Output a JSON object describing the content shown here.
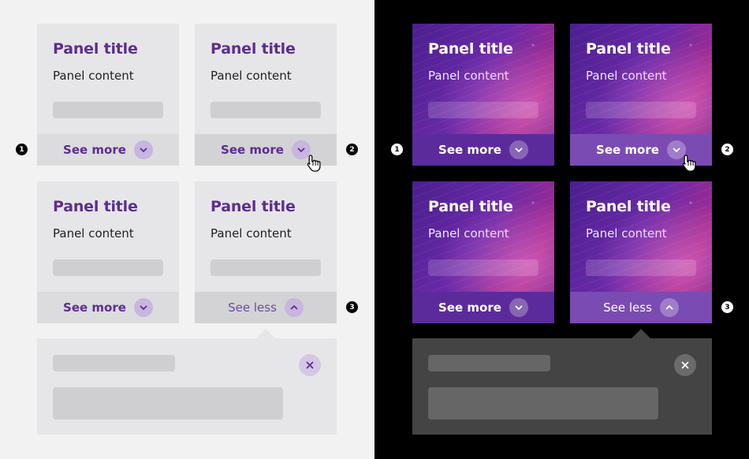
{
  "panel": {
    "title": "Panel title",
    "content": "Panel content"
  },
  "toggle": {
    "see_more": "See more",
    "see_less": "See less"
  },
  "markers": {
    "one": "1",
    "two": "2",
    "three": "3"
  },
  "icons": {
    "chevron_down": "chevron-down-icon",
    "chevron_up": "chevron-up-icon",
    "close": "close-icon",
    "cursor": "hand-pointer-icon"
  },
  "colors": {
    "light_background": "#f2f2f2",
    "dark_background": "#000000",
    "light_panel": "#e6e6e8",
    "brand_purple": "#5c2d91",
    "dark_toggle": "#5b2b9c",
    "dark_expanded": "#444444"
  }
}
